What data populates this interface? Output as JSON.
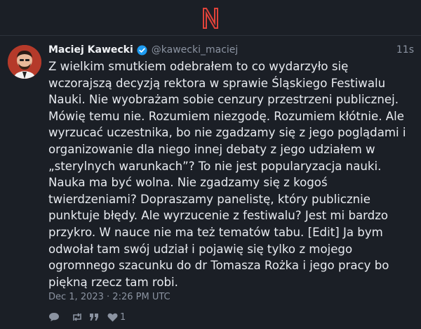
{
  "app": {
    "logo_icon": "n-logo-icon",
    "accent": "#e0433a"
  },
  "post": {
    "author_name": "Maciej Kawecki",
    "handle": "@kawecki_maciej",
    "time_ago": "11s",
    "verified_color": "#1d9bf0",
    "lines": [
      "Z wielkim smutkiem odebrałem to co wydarzyło się",
      "wczorajszą decyzją rektora w sprawie Śląskiego Festiwalu",
      "Nauki. Nie wyobrażam sobie cenzury przestrzeni publicznej.",
      "Mówię temu nie. Rozumiem niezgodę. Rozumiem kłótnie. Ale",
      "wyrzucać uczestnika, bo nie zgadzamy się z jego poglądami i",
      "organizowanie dla niego innej debaty z jego udziałem w",
      "„sterylnych warunkach”? To nie jest popularyzacja nauki.",
      "Nauka ma być wolna. Nie zgadzamy się z kogoś",
      "twierdzeniami? Dopraszamy panelistę, który publicznie",
      "punktuje błędy. Ale wyrzucenie z festiwalu? Jest mi bardzo",
      "przykro. W nauce nie ma też tematów tabu. [Edit] Ja bym",
      "odwołał tam swój udział i pojawię się tylko z mojego",
      "ogromnego szacunku do dr Tomasza Rożka i jego pracy bo",
      "piękną rzecz tam robi."
    ],
    "date": "Dec 1, 2023 · 2:26 PM UTC",
    "like_count": "1"
  }
}
